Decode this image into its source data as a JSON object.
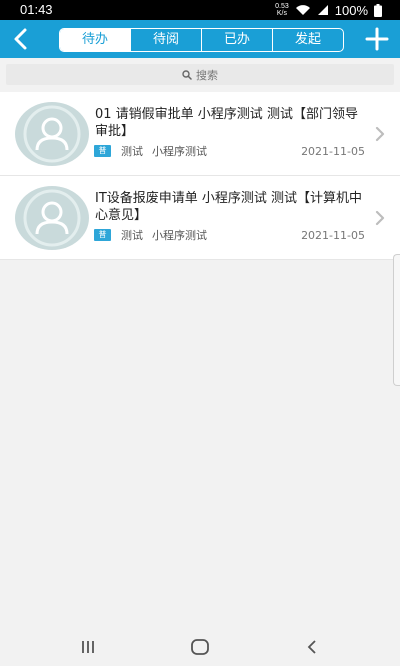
{
  "status_bar": {
    "time": "01:43",
    "net_speed_value": "0.53",
    "net_speed_unit": "K/s",
    "battery": "100%"
  },
  "header": {
    "tabs": [
      {
        "label": "待办",
        "active": true
      },
      {
        "label": "待阅",
        "active": false
      },
      {
        "label": "已办",
        "active": false
      },
      {
        "label": "发起",
        "active": false
      }
    ],
    "colors": {
      "accent": "#1a9fd6"
    }
  },
  "search": {
    "label": "搜索"
  },
  "items": [
    {
      "title": "01 请销假审批单 小程序测试 测试【部门领导审批】",
      "badge": "普",
      "tag1": "测试",
      "tag2": "小程序测试",
      "date": "2021-11-05"
    },
    {
      "title": "IT设备报废申请单 小程序测试 测试【计算机中心意见】",
      "badge": "普",
      "tag1": "测试",
      "tag2": "小程序测试",
      "date": "2021-11-05"
    }
  ],
  "icons": {
    "back": "chevron-left-icon",
    "add": "plus-icon",
    "search": "search-icon",
    "avatar": "user-avatar-icon",
    "item_arrow": "chevron-right-icon",
    "nav_recent": "recent-apps-icon",
    "nav_home": "home-icon",
    "nav_back": "back-icon"
  }
}
